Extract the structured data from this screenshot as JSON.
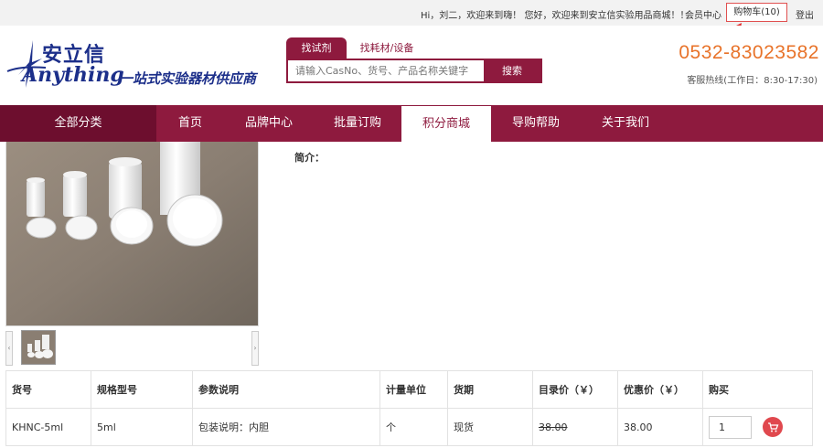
{
  "topbar": {
    "greeting": "Hi，刘二，欢迎来到嗨！ 您好，欢迎来到安立信实验用品商城！！",
    "member": "会员中心",
    "cart": "购物车(10)",
    "logout": "登出"
  },
  "header": {
    "logo_cn": "安立信",
    "logo_en": "Anything",
    "slogan": "一站式实验器材供应商",
    "search_tabs": [
      "找试剂",
      "找耗材/设备"
    ],
    "search_placeholder": "请输入CasNo、货号、产品名称关键字",
    "search_button": "搜索",
    "phone": "0532-83023582",
    "hours": "客服热线(工作日：8:30-17:30)"
  },
  "nav": {
    "all": "全部分类",
    "items": [
      "首页",
      "品牌中心",
      "批量订购",
      "积分商城",
      "导购帮助",
      "关于我们"
    ],
    "active_index": 3
  },
  "product": {
    "intro_label": "简介："
  },
  "table": {
    "headers": [
      "货号",
      "规格型号",
      "参数说明",
      "计量单位",
      "货期",
      "目录价（￥）",
      "优惠价（￥）",
      "购买"
    ],
    "rows": [
      {
        "sku": "KHNC-5ml",
        "spec": "5ml",
        "param": "包装说明：内胆",
        "unit": "个",
        "lead": "现货",
        "list_price": "38.00",
        "sale_price": "38.00",
        "qty": "1"
      }
    ]
  },
  "colors": {
    "brand": "#8e1a3e",
    "phone": "#e8732a",
    "price_red": "#d9303a"
  }
}
